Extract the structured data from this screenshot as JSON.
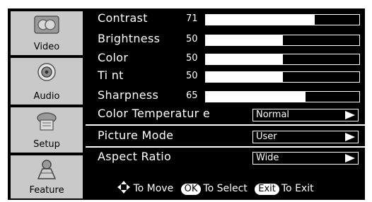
{
  "sidebar": {
    "tabs": [
      {
        "label": "Video",
        "icon": "video-icon",
        "active": true
      },
      {
        "label": "Audio",
        "icon": "speaker-icon",
        "active": false
      },
      {
        "label": "Setup",
        "icon": "setup-icon",
        "active": false
      },
      {
        "label": "Feature",
        "icon": "feature-icon",
        "active": false
      }
    ]
  },
  "settings": {
    "contrast": {
      "label": "Contrast",
      "value": "71",
      "level": 71
    },
    "brightness": {
      "label": "Brightness",
      "value": "50",
      "level": 50
    },
    "color": {
      "label": "Color",
      "value": "50",
      "level": 50
    },
    "tint": {
      "label": "Ti nt",
      "value": "50",
      "level": 50
    },
    "sharpness": {
      "label": "Sharpness",
      "value": "65",
      "level": 65
    },
    "color_temperature": {
      "label": "Color  Temperatur  e",
      "value": "Normal"
    },
    "picture_mode": {
      "label": "Picture  Mode",
      "value": "User"
    },
    "aspect_ratio": {
      "label": "Aspect  Ratio",
      "value": "Wide"
    }
  },
  "footer": {
    "move_icon": "four-way-arrow-icon",
    "move_label": "To Move",
    "ok_key": "OK",
    "select_label": "To Select",
    "exit_key": "Exit",
    "exit_label": "To Exit"
  },
  "colors": {
    "background": "#000000",
    "text": "#ffffff",
    "sidebar_tab": "#c9c9c9"
  }
}
